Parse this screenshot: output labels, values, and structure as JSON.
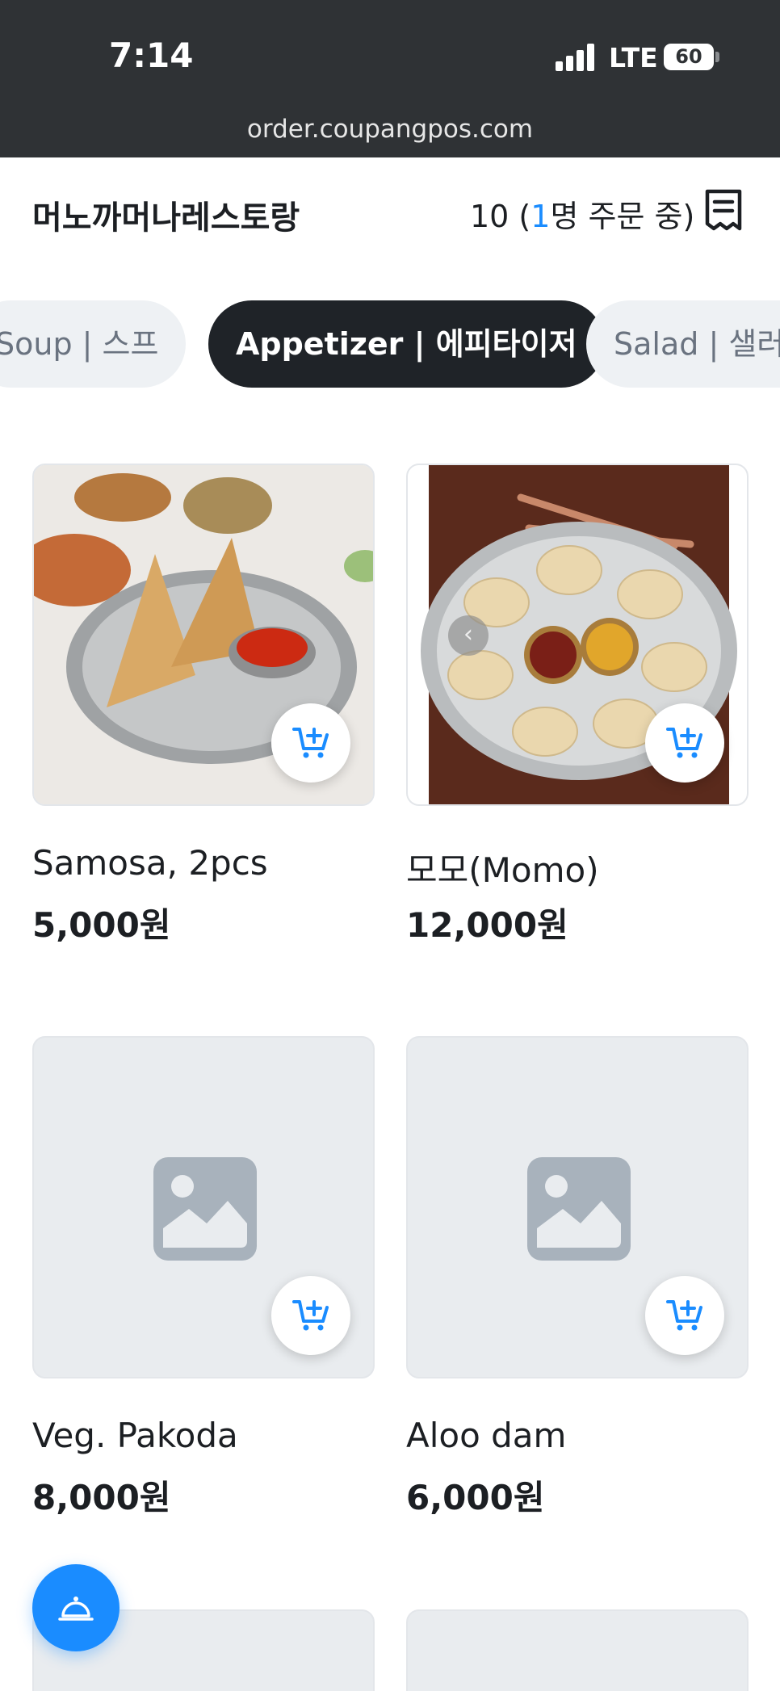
{
  "status_bar": {
    "time": "7:14",
    "network": "LTE",
    "battery": "60"
  },
  "browser": {
    "url": "order.coupangpos.com"
  },
  "header": {
    "store_name": "머노까머나레스토랑",
    "table_prefix": "10 (",
    "ordering_count": "1",
    "table_suffix": "명 주문 중)"
  },
  "categories": [
    {
      "label": "Soup | 스프",
      "active": false
    },
    {
      "label": "Appetizer | 에피타이저",
      "active": true
    },
    {
      "label": "Salad | 샐러드",
      "active": false
    }
  ],
  "menu_items": [
    {
      "name": "Samosa, 2pcs",
      "price": "5,000원",
      "image": "samosa-photo"
    },
    {
      "name": "모모(Momo)",
      "price": "12,000원",
      "image": "momo-photo"
    },
    {
      "name": "Veg. Pakoda",
      "price": "8,000원",
      "image": "placeholder-image-icon"
    },
    {
      "name": "Aloo dam",
      "price": "6,000원",
      "image": "placeholder-image-icon"
    }
  ],
  "icons": {
    "receipt": "receipt-icon",
    "add_to_cart": "add-to-cart-icon",
    "call_staff": "service-bell-icon"
  },
  "colors": {
    "accent": "#1a8cff",
    "active_tab": "#1f2328",
    "placeholder": "#e9ecef"
  }
}
